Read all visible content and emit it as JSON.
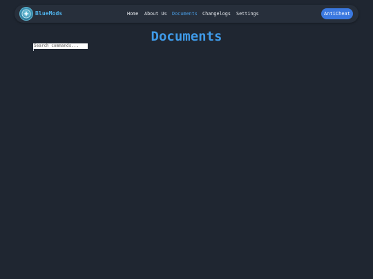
{
  "brand": {
    "name": "BlueMods"
  },
  "nav": {
    "home": "Home",
    "about": "About Us",
    "documents": "Documents",
    "changelogs": "Changelogs",
    "settings": "Settings",
    "active": "documents"
  },
  "cta": {
    "label": "AntiCheat"
  },
  "main": {
    "title": "Documents",
    "search": {
      "placeholder": "Search commands...",
      "value": ""
    }
  },
  "colors": {
    "background": "#1f2631",
    "navbar": "#272f3b",
    "accent": "#3f9ae8",
    "cta": "#3a78e0"
  },
  "icons": {
    "logo": "bluemods-logo-icon"
  }
}
